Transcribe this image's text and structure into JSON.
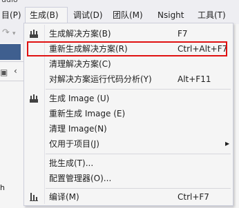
{
  "window": {
    "title_fragment": "udio"
  },
  "menubar": {
    "items": [
      {
        "label": "目(P)"
      },
      {
        "label": "生成(B)"
      },
      {
        "label": "调试(D)"
      },
      {
        "label": "团队(M)"
      },
      {
        "label": "Nsight"
      },
      {
        "label": "工具(T)"
      }
    ]
  },
  "left_panel": {
    "text_fragment": "h"
  },
  "build_menu": {
    "items": [
      {
        "icon": "build-solution-icon",
        "label": "生成解决方案(B)",
        "shortcut": "F7"
      },
      {
        "icon": "",
        "label": "重新生成解决方案(R)",
        "shortcut": "Ctrl+Alt+F7"
      },
      {
        "icon": "",
        "label": "清理解决方案(C)",
        "shortcut": ""
      },
      {
        "icon": "",
        "label": "对解决方案运行代码分析(Y)",
        "shortcut": "Alt+F11"
      },
      {
        "icon": "build-image-icon",
        "label": "生成 Image (U)",
        "shortcut": ""
      },
      {
        "icon": "",
        "label": "重新生成 Image (E)",
        "shortcut": ""
      },
      {
        "icon": "",
        "label": "清理 Image(N)",
        "shortcut": ""
      },
      {
        "icon": "",
        "label": "仅用于项目(J)",
        "shortcut": "",
        "submenu": true
      },
      {
        "icon": "",
        "label": "批生成(T)...",
        "shortcut": ""
      },
      {
        "icon": "",
        "label": "配置管理器(O)...",
        "shortcut": ""
      },
      {
        "icon": "compile-icon",
        "label": "编译(M)",
        "shortcut": "Ctrl+F7"
      }
    ],
    "highlighted_item": "重新生成解决方案(R)",
    "highlight_color": "#e01010"
  }
}
